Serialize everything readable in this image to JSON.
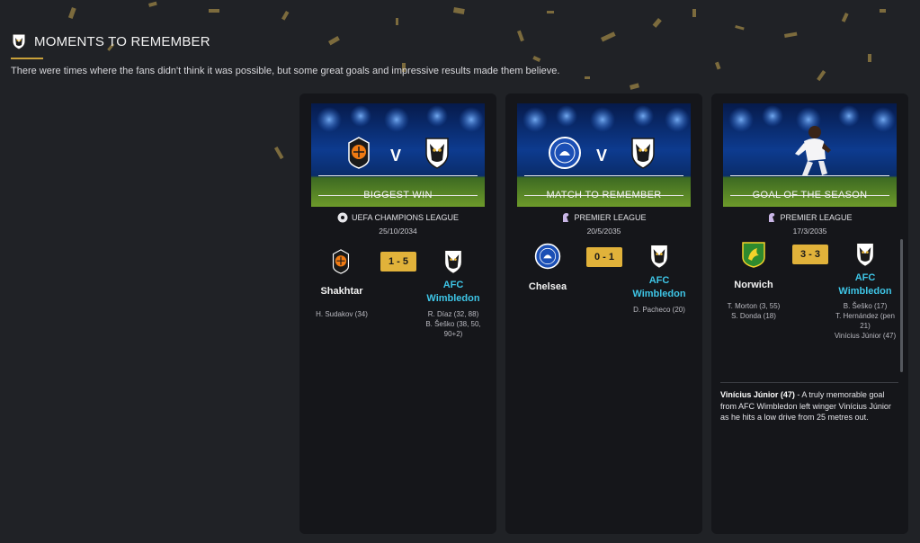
{
  "header": {
    "title": "MOMENTS TO REMEMBER",
    "subtitle": "There were times where the fans didn't think it was possible, but some great goals and impressive results made them believe."
  },
  "colors": {
    "accent_gold": "#e1b23a",
    "team_cyan": "#3ec5e6",
    "card_bg": "#15161a",
    "page_bg": "#202226"
  },
  "cards": [
    {
      "banner_label": "BIGGEST WIN",
      "competition": "UEFA CHAMPIONS LEAGUE",
      "competition_icon": "champions-league-icon",
      "date": "25/10/2034",
      "home": {
        "name": "Shakhtar",
        "crest": "shakhtar-crest-icon",
        "scorers": [
          "H. Sudakov (34)"
        ]
      },
      "away": {
        "name_line1": "AFC",
        "name_line2": "Wimbledon",
        "crest": "afc-wimbledon-crest-icon",
        "scorers": [
          "R. Díaz (32, 88)",
          "B. Šeško (38, 50,",
          "90+2)"
        ]
      },
      "score": "1 - 5",
      "vs": "V"
    },
    {
      "banner_label": "MATCH TO REMEMBER",
      "competition": "PREMIER LEAGUE",
      "competition_icon": "premier-league-icon",
      "date": "20/5/2035",
      "home": {
        "name": "Chelsea",
        "crest": "chelsea-crest-icon",
        "scorers": []
      },
      "away": {
        "name_line1": "AFC",
        "name_line2": "Wimbledon",
        "crest": "afc-wimbledon-crest-icon",
        "scorers": [
          "D. Pacheco (20)"
        ]
      },
      "score": "0 - 1",
      "vs": "V"
    },
    {
      "banner_label": "GOAL OF THE SEASON",
      "competition": "PREMIER LEAGUE",
      "competition_icon": "premier-league-icon",
      "date": "17/3/2035",
      "home": {
        "name": "Norwich",
        "crest": "norwich-crest-icon",
        "scorers": [
          "T. Morton (3, 55)",
          "S. Donda (18)"
        ]
      },
      "away": {
        "name_line1": "AFC",
        "name_line2": "Wimbledon",
        "crest": "afc-wimbledon-crest-icon",
        "scorers": [
          "B. Šeško (17)",
          "T. Hernández (pen",
          "21)",
          "Vinícius Júnior (47)"
        ]
      },
      "score": "3 - 3",
      "description": {
        "player": "Vinícius Júnior (47)",
        "text": " - A truly memorable goal from AFC Wimbledon left winger Vinícius Júnior as he hits a low drive from 25 metres out."
      }
    }
  ]
}
